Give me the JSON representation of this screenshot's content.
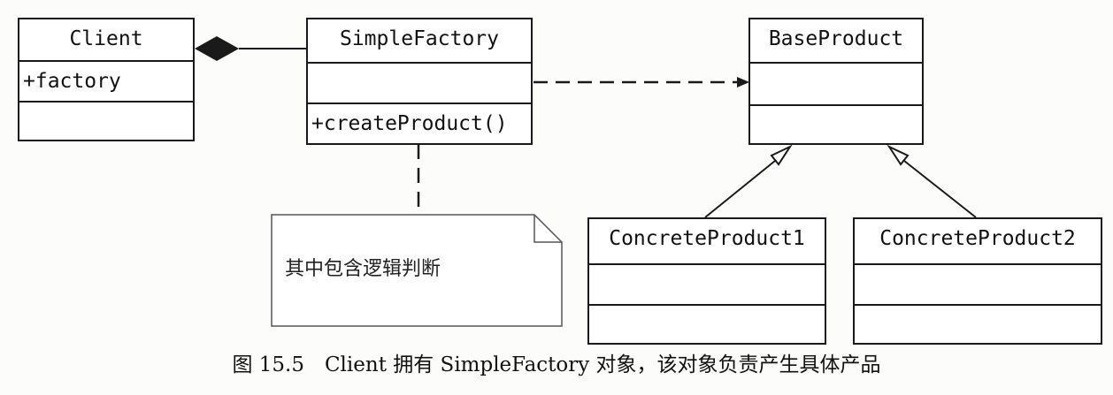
{
  "classes": {
    "client": {
      "name": "Client",
      "attributes": [
        "+factory"
      ],
      "operations": []
    },
    "simple_factory": {
      "name": "SimpleFactory",
      "attributes": [],
      "operations": [
        "+createProduct()"
      ]
    },
    "base_product": {
      "name": "BaseProduct",
      "attributes": [],
      "operations": []
    },
    "concrete_product_1": {
      "name": "ConcreteProduct1",
      "attributes": [],
      "operations": []
    },
    "concrete_product_2": {
      "name": "ConcreteProduct2",
      "attributes": [],
      "operations": []
    }
  },
  "relations": [
    {
      "type": "composition",
      "from": "client",
      "to": "simple_factory"
    },
    {
      "type": "dependency",
      "from": "simple_factory",
      "to": "base_product"
    },
    {
      "type": "generalization",
      "from": "concrete_product_1",
      "to": "base_product"
    },
    {
      "type": "generalization",
      "from": "concrete_product_2",
      "to": "base_product"
    },
    {
      "type": "note-anchor",
      "from": "note",
      "to": "simple_factory"
    }
  ],
  "note": {
    "text": "其中包含逻辑判断"
  },
  "caption": {
    "text": "图 15.5　Client 拥有 SimpleFactory 对象，该对象负责产生具体产品"
  }
}
